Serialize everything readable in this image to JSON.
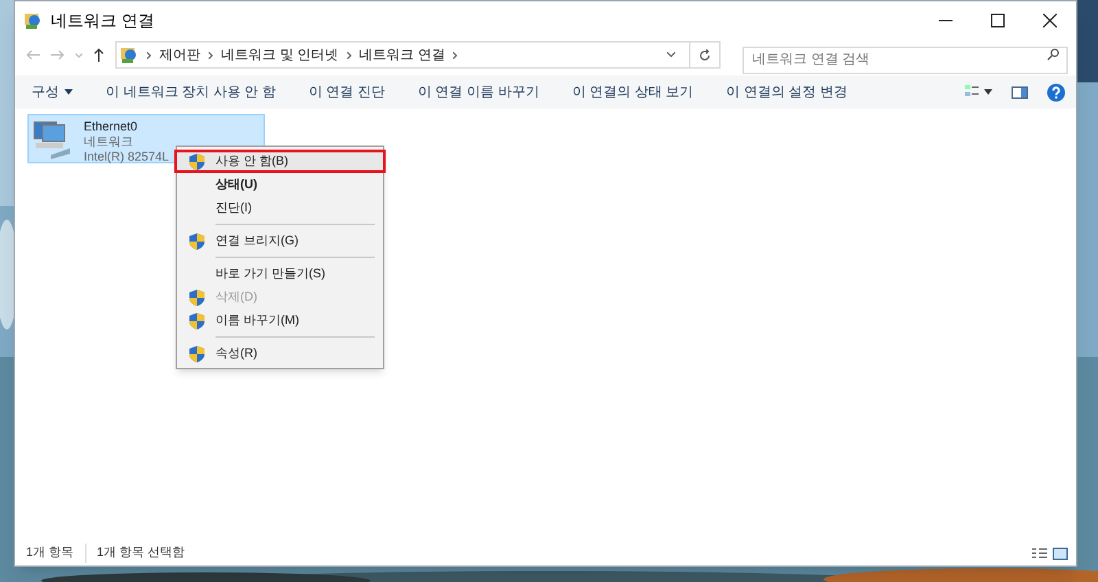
{
  "window": {
    "title": "네트워크 연결"
  },
  "address": {
    "crumbs": [
      "제어판",
      "네트워크 및 인터넷",
      "네트워크 연결"
    ]
  },
  "search": {
    "placeholder": "네트워크 연결 검색"
  },
  "toolbar": {
    "items": [
      {
        "label": "구성",
        "dropdown": true
      },
      {
        "label": "이 네트워크 장치 사용 안 함",
        "dropdown": false
      },
      {
        "label": "이 연결 진단",
        "dropdown": false
      },
      {
        "label": "이 연결 이름 바꾸기",
        "dropdown": false
      },
      {
        "label": "이 연결의 상태 보기",
        "dropdown": false
      },
      {
        "label": "이 연결의 설정 변경",
        "dropdown": false
      }
    ]
  },
  "items": [
    {
      "name": "Ethernet0",
      "type": "네트워크",
      "device": "Intel(R) 82574L",
      "selected": true
    }
  ],
  "context_menu": [
    {
      "kind": "item",
      "label": "사용 안 함(B)",
      "shield": true,
      "bold": false,
      "disabled": false,
      "selected": true
    },
    {
      "kind": "item",
      "label": "상태(U)",
      "shield": false,
      "bold": true,
      "disabled": false,
      "selected": false
    },
    {
      "kind": "item",
      "label": "진단(I)",
      "shield": false,
      "bold": false,
      "disabled": false,
      "selected": false
    },
    {
      "kind": "separator"
    },
    {
      "kind": "item",
      "label": "연결 브리지(G)",
      "shield": true,
      "bold": false,
      "disabled": false,
      "selected": false
    },
    {
      "kind": "separator"
    },
    {
      "kind": "item",
      "label": "바로 가기 만들기(S)",
      "shield": false,
      "bold": false,
      "disabled": false,
      "selected": false
    },
    {
      "kind": "item",
      "label": "삭제(D)",
      "shield": true,
      "bold": false,
      "disabled": true,
      "selected": false
    },
    {
      "kind": "item",
      "label": "이름 바꾸기(M)",
      "shield": true,
      "bold": false,
      "disabled": false,
      "selected": false
    },
    {
      "kind": "separator"
    },
    {
      "kind": "item",
      "label": "속성(R)",
      "shield": true,
      "bold": false,
      "disabled": false,
      "selected": false
    }
  ],
  "status_bar": [
    "1개 항목",
    "1개 항목 선택함"
  ]
}
